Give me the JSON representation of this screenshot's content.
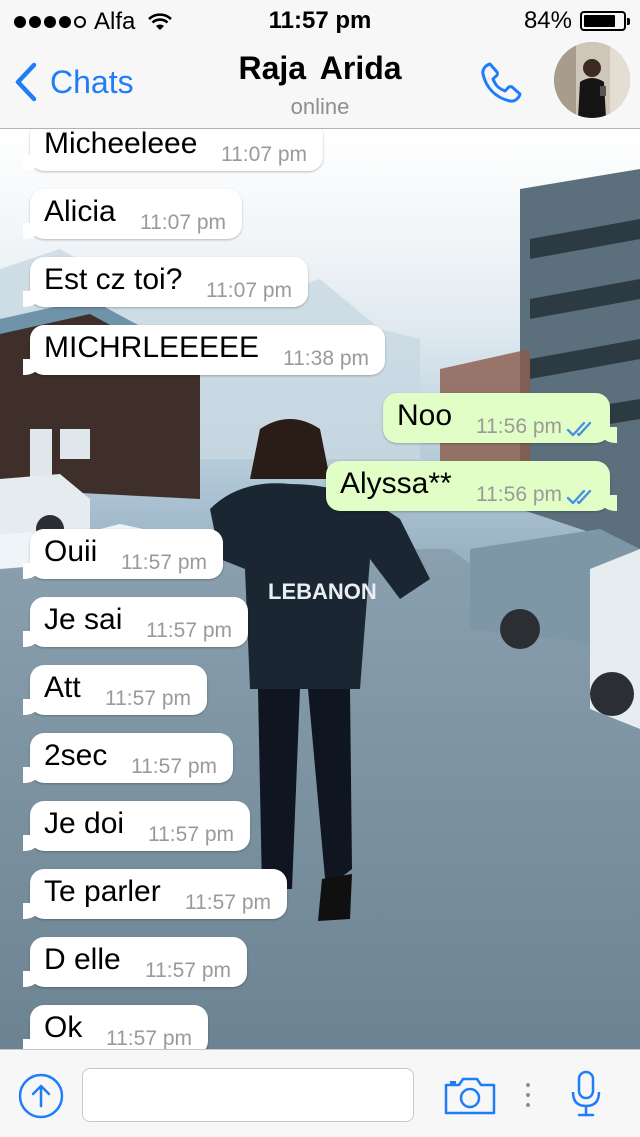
{
  "status_bar": {
    "carrier": "Alfa",
    "time": "11:57 pm",
    "battery_percent": "84%",
    "battery_level": 0.84,
    "signal_bars_filled": 4
  },
  "nav": {
    "back_label": "Chats",
    "contact_name": "Raja  Arida",
    "status": "online",
    "accent_color": "#1f7ef7"
  },
  "messages": [
    {
      "direction": "in",
      "text": "Micheeleee",
      "time": "11:07 pm"
    },
    {
      "direction": "in",
      "text": "Alicia",
      "time": "11:07 pm"
    },
    {
      "direction": "in",
      "text": "Est cz toi?",
      "time": "11:07 pm"
    },
    {
      "direction": "in",
      "text": "MICHRLEEEEE",
      "time": "11:38 pm"
    },
    {
      "direction": "out",
      "text": "Noo",
      "time": "11:56 pm",
      "status": "read"
    },
    {
      "direction": "out",
      "text": "Alyssa**",
      "time": "11:56 pm",
      "status": "read"
    },
    {
      "direction": "in",
      "text": "Ouii",
      "time": "11:57 pm"
    },
    {
      "direction": "in",
      "text": "Je sai",
      "time": "11:57 pm"
    },
    {
      "direction": "in",
      "text": "Att",
      "time": "11:57 pm"
    },
    {
      "direction": "in",
      "text": "2sec",
      "time": "11:57 pm"
    },
    {
      "direction": "in",
      "text": "Je doi",
      "time": "11:57 pm"
    },
    {
      "direction": "in",
      "text": "Te parler",
      "time": "11:57 pm"
    },
    {
      "direction": "in",
      "text": "D elle",
      "time": "11:57 pm"
    },
    {
      "direction": "in",
      "text": "Ok",
      "time": "11:57 pm"
    }
  ],
  "wallpaper": {
    "jacket_text": "LEBANON"
  },
  "input_bar": {
    "placeholder": "",
    "icons": [
      "share-icon",
      "camera-icon",
      "more-dots-icon",
      "microphone-icon"
    ]
  },
  "colors": {
    "outgoing_bubble": "#e1fec6",
    "incoming_bubble": "#ffffff",
    "read_ticks": "#4a90e2"
  }
}
